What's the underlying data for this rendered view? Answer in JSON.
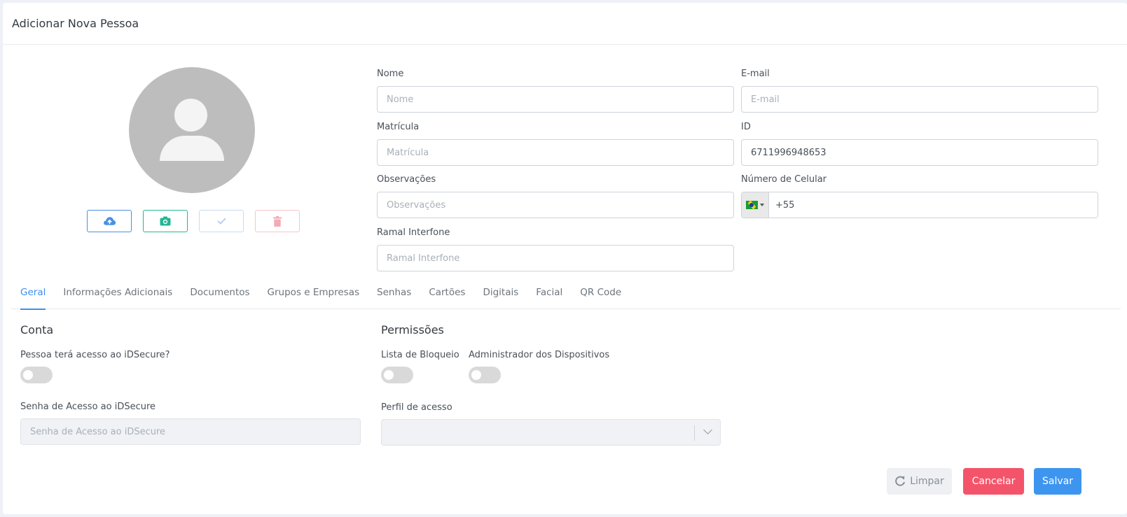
{
  "header": {
    "title": "Adicionar Nova Pessoa"
  },
  "photo": {
    "buttons": [
      {
        "name": "upload",
        "icon": "cloud-upload-icon"
      },
      {
        "name": "camera",
        "icon": "camera-icon"
      },
      {
        "name": "confirm",
        "icon": "check-icon"
      },
      {
        "name": "delete",
        "icon": "trash-icon"
      }
    ]
  },
  "form": {
    "nome": {
      "label": "Nome",
      "placeholder": "Nome",
      "value": ""
    },
    "email": {
      "label": "E-mail",
      "placeholder": "E-mail",
      "value": ""
    },
    "matricula": {
      "label": "Matrícula",
      "placeholder": "Matrícula",
      "value": ""
    },
    "id": {
      "label": "ID",
      "value": "6711996948653"
    },
    "observacoes": {
      "label": "Observações",
      "placeholder": "Observações",
      "value": ""
    },
    "celular": {
      "label": "Número de Celular",
      "value": "+55",
      "flag_icon": "brazil-flag-icon"
    },
    "ramal": {
      "label": "Ramal Interfone",
      "placeholder": "Ramal Interfone",
      "value": ""
    }
  },
  "tabs": [
    {
      "label": "Geral",
      "active": true
    },
    {
      "label": "Informações Adicionais"
    },
    {
      "label": "Documentos"
    },
    {
      "label": "Grupos e Empresas"
    },
    {
      "label": "Senhas"
    },
    {
      "label": "Cartões"
    },
    {
      "label": "Digitais"
    },
    {
      "label": "Facial"
    },
    {
      "label": "QR Code"
    }
  ],
  "conta": {
    "title": "Conta",
    "acesso_label": "Pessoa terá acesso ao iDSecure?",
    "acesso_on": false,
    "senha_label": "Senha de Acesso ao iDSecure",
    "senha_placeholder": "Senha de Acesso ao iDSecure"
  },
  "permissoes": {
    "title": "Permissões",
    "bloqueio_label": "Lista de Bloqueio",
    "bloqueio_on": false,
    "admin_label": "Administrador dos Dispositivos",
    "admin_on": false,
    "perfil_label": "Perfil de acesso",
    "perfil_value": ""
  },
  "actions": {
    "clear_label": "Limpar",
    "cancel_label": "Cancelar",
    "save_label": "Salvar"
  },
  "colors": {
    "primary": "#3e95f0",
    "danger": "#f4546a",
    "success": "#20b894"
  }
}
